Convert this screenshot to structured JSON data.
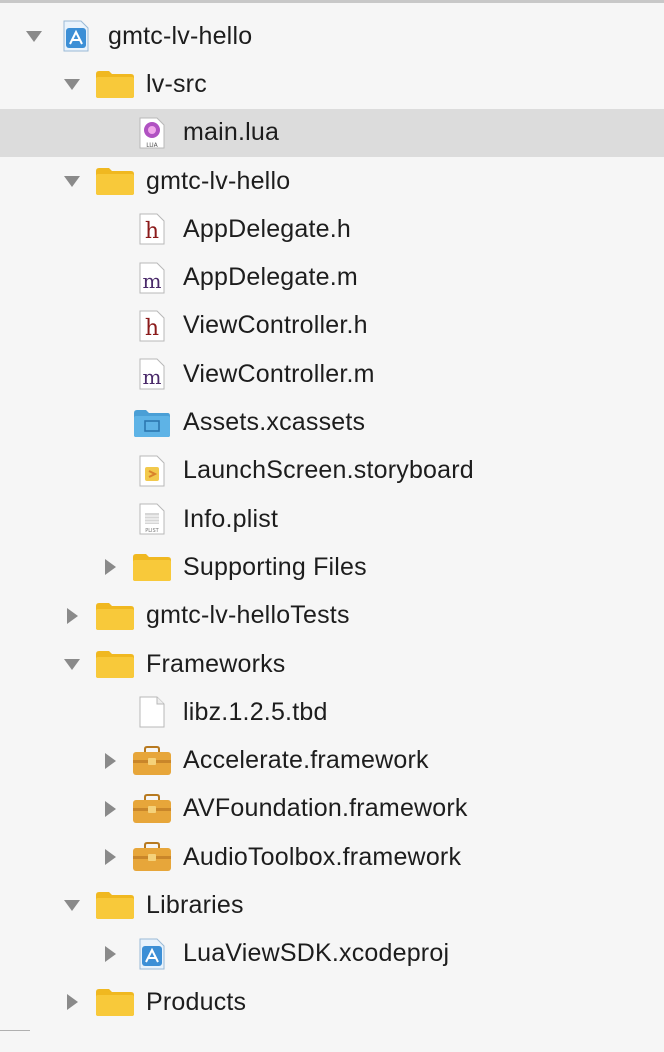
{
  "navigator": {
    "items": [
      {
        "label": "gmtc-lv-hello",
        "icon": "xcode-project-icon",
        "level": 0,
        "disclosure": "expanded",
        "selected": false
      },
      {
        "label": "lv-src",
        "icon": "folder-icon",
        "level": 1,
        "disclosure": "expanded",
        "selected": false
      },
      {
        "label": "main.lua",
        "icon": "lua-file-icon",
        "level": 2,
        "disclosure": "none",
        "selected": true
      },
      {
        "label": "gmtc-lv-hello",
        "icon": "folder-icon",
        "level": 1,
        "disclosure": "expanded",
        "selected": false
      },
      {
        "label": "AppDelegate.h",
        "icon": "header-file-icon",
        "level": 2,
        "disclosure": "none",
        "selected": false
      },
      {
        "label": "AppDelegate.m",
        "icon": "objc-file-icon",
        "level": 2,
        "disclosure": "none",
        "selected": false
      },
      {
        "label": "ViewController.h",
        "icon": "header-file-icon",
        "level": 2,
        "disclosure": "none",
        "selected": false
      },
      {
        "label": "ViewController.m",
        "icon": "objc-file-icon",
        "level": 2,
        "disclosure": "none",
        "selected": false
      },
      {
        "label": "Assets.xcassets",
        "icon": "asset-catalog-icon",
        "level": 2,
        "disclosure": "none",
        "selected": false
      },
      {
        "label": "LaunchScreen.storyboard",
        "icon": "storyboard-file-icon",
        "level": 2,
        "disclosure": "none",
        "selected": false
      },
      {
        "label": "Info.plist",
        "icon": "plist-file-icon",
        "level": 2,
        "disclosure": "none",
        "selected": false
      },
      {
        "label": "Supporting Files",
        "icon": "folder-icon",
        "level": 2,
        "disclosure": "collapsed",
        "selected": false
      },
      {
        "label": "gmtc-lv-helloTests",
        "icon": "folder-icon",
        "level": 1,
        "disclosure": "collapsed",
        "selected": false
      },
      {
        "label": "Frameworks",
        "icon": "folder-icon",
        "level": 1,
        "disclosure": "expanded",
        "selected": false
      },
      {
        "label": "libz.1.2.5.tbd",
        "icon": "blank-file-icon",
        "level": 2,
        "disclosure": "none",
        "selected": false
      },
      {
        "label": "Accelerate.framework",
        "icon": "framework-icon",
        "level": 2,
        "disclosure": "collapsed",
        "selected": false
      },
      {
        "label": "AVFoundation.framework",
        "icon": "framework-icon",
        "level": 2,
        "disclosure": "collapsed",
        "selected": false
      },
      {
        "label": "AudioToolbox.framework",
        "icon": "framework-icon",
        "level": 2,
        "disclosure": "collapsed",
        "selected": false
      },
      {
        "label": "Libraries",
        "icon": "folder-icon",
        "level": 1,
        "disclosure": "expanded",
        "selected": false
      },
      {
        "label": "LuaViewSDK.xcodeproj",
        "icon": "xcode-project-icon",
        "level": 2,
        "disclosure": "collapsed",
        "selected": false
      },
      {
        "label": "Products",
        "icon": "folder-icon",
        "level": 1,
        "disclosure": "collapsed",
        "selected": false
      }
    ]
  },
  "glyphs": {
    "header": "h",
    "objc": "m",
    "lua_tag": "LUA",
    "plist_tag": "PLIST"
  },
  "colors": {
    "folder": "#f8c93a",
    "folder_tab": "#f0b820",
    "framework": "#e7a63a",
    "selection": "#dcdcdc",
    "header_glyph": "#8b1a1a",
    "objc_glyph": "#4a2a6a",
    "asset_blue": "#5eb3e6",
    "xcode_blue": "#3c8fd6",
    "disclosure": "#8a8a8a"
  }
}
